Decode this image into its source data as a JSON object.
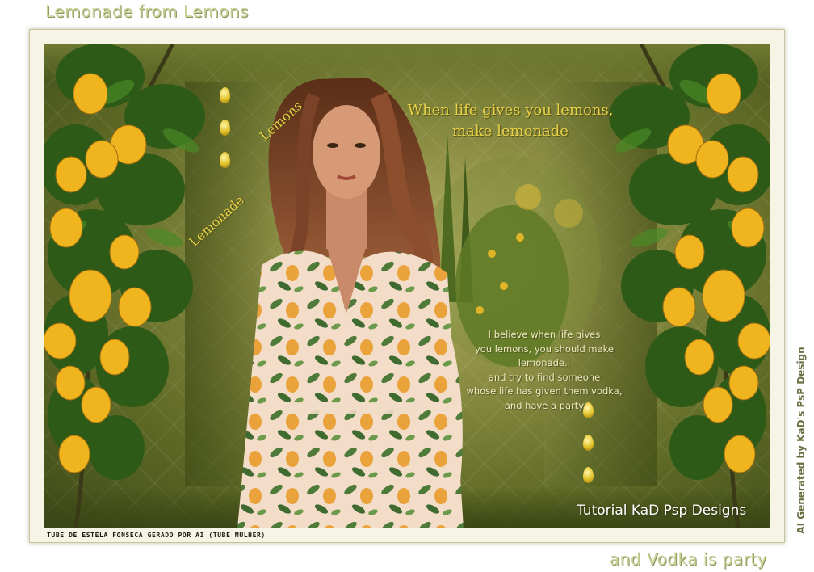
{
  "titles": {
    "top": "Lemonade from Lemons",
    "bottom": "and Vodka is party",
    "side_credit": "AI Generated by KaD's PsP Design"
  },
  "artwork": {
    "label_lemons": "Lemons",
    "label_lemonade": "Lemonade",
    "quote_main_line1": "When life gives you lemons,",
    "quote_main_line2": "make lemonade",
    "quote_block": [
      "I believe when life gives",
      "you lemons, you should make lemonade..",
      "and try to find someone",
      "whose life has given them vodka,",
      "and have a party"
    ],
    "signature": "Tutorial KaD Psp Designs",
    "tube_credit": "TUBE DE ESTELA FONSECA GERADO POR AI (TUBE MULHER)"
  },
  "colors": {
    "background": "#ffffff",
    "frame": "#f6f4e4",
    "title_text": "#c9d29a",
    "accent_gold": "#e7d24a",
    "lemon": "#f0b41e",
    "leaf": "#2e5a18"
  },
  "icons": {
    "drops": "gold-drop-icon",
    "signature_logo": "cat-logo-icon"
  }
}
